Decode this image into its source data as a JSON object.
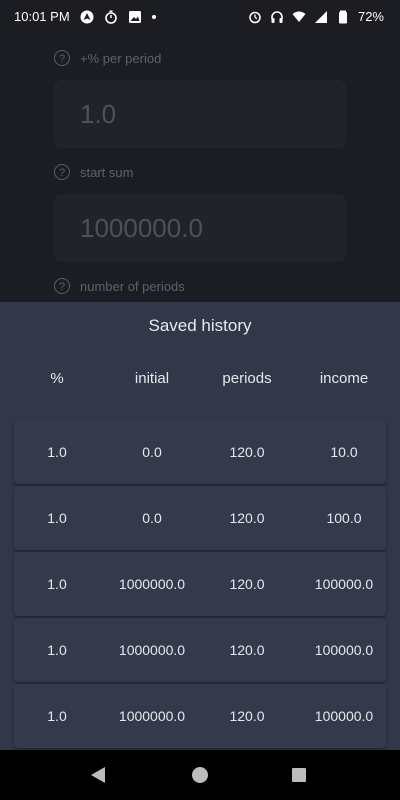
{
  "status_bar": {
    "time": "10:01 PM",
    "battery": "72%",
    "left_icons": [
      "android-auto-icon",
      "stopwatch-icon",
      "image-icon",
      "dot-icon"
    ],
    "right_icons": [
      "alarm-icon",
      "headphones-icon",
      "wifi-icon",
      "signal-icon",
      "battery-icon"
    ]
  },
  "form": {
    "fields": [
      {
        "label": "+% per period",
        "value": "1.0"
      },
      {
        "label": "start sum",
        "value": "1000000.0"
      },
      {
        "label": "number of periods",
        "value": ""
      }
    ]
  },
  "history": {
    "title": "Saved history",
    "columns": [
      "%",
      "initial",
      "periods",
      "income"
    ],
    "rows": [
      [
        "1.0",
        "0.0",
        "120.0",
        "10.0"
      ],
      [
        "1.0",
        "0.0",
        "120.0",
        "100.0"
      ],
      [
        "1.0",
        "1000000.0",
        "120.0",
        "100000.0"
      ],
      [
        "1.0",
        "1000000.0",
        "120.0",
        "100000.0"
      ],
      [
        "1.0",
        "1000000.0",
        "120.0",
        "100000.0"
      ]
    ]
  },
  "colors": {
    "background": "#1b1d23",
    "sheet": "#323849",
    "row": "#343a4b",
    "text": "#e6e8ec"
  }
}
